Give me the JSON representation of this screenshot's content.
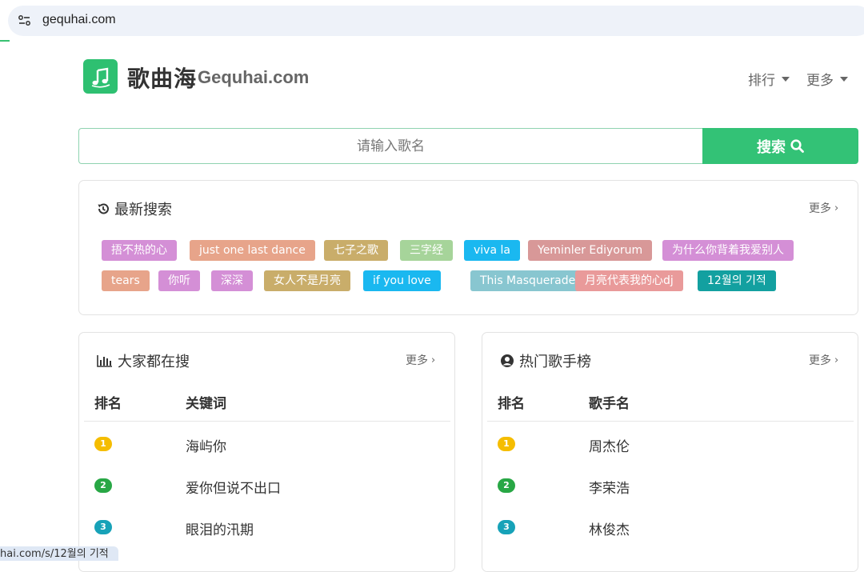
{
  "browser": {
    "url": "gequhai.com"
  },
  "header": {
    "logo_cn": "歌曲海",
    "logo_en": "Gequhai.com",
    "nav": [
      {
        "label": "排行"
      },
      {
        "label": "更多"
      }
    ]
  },
  "search": {
    "placeholder": "请输入歌名",
    "button_label": "搜索"
  },
  "recent": {
    "title": "最新搜索",
    "more": "更多",
    "tags": [
      {
        "text": "捂不热的心",
        "color": "#d48fd6"
      },
      {
        "text": "just one last dance",
        "color": "#e7a48a"
      },
      {
        "text": "七子之歌",
        "color": "#c9ad6a"
      },
      {
        "text": "三字经",
        "color": "#a6d49a"
      },
      {
        "text": "viva la",
        "color": "#1ab8f0"
      },
      {
        "text": "Yeminler Ediyorum",
        "color": "#d89898"
      },
      {
        "text": "为什么你背着我爱别人",
        "color": "#d48fd6"
      },
      {
        "text": "tears",
        "color": "#e7a48a"
      },
      {
        "text": "你听",
        "color": "#d48fd6"
      },
      {
        "text": "深深",
        "color": "#d48fd6"
      },
      {
        "text": "女人不是月亮",
        "color": "#c9ad6a"
      },
      {
        "text": "if you love",
        "color": "#1ab8f0"
      },
      {
        "text": "This Masquerade",
        "color": "#88c6d0"
      },
      {
        "text": "月亮代表我的心dj",
        "color": "#e99a9a"
      },
      {
        "text": "12월의 기적",
        "color": "#13a0a0"
      }
    ]
  },
  "popular": {
    "title": "大家都在搜",
    "more": "更多",
    "col_rank": "排名",
    "col_name": "关键词",
    "rows": [
      {
        "rank": "1",
        "name": "海屿你",
        "color": "#f5bd00"
      },
      {
        "rank": "2",
        "name": "爱你但说不出口",
        "color": "#28a745"
      },
      {
        "rank": "3",
        "name": "眼泪的汛期",
        "color": "#17a2b8"
      }
    ]
  },
  "singers": {
    "title": "热门歌手榜",
    "more": "更多",
    "col_rank": "排名",
    "col_name": "歌手名",
    "rows": [
      {
        "rank": "1",
        "name": "周杰伦",
        "color": "#f5bd00"
      },
      {
        "rank": "2",
        "name": "李荣浩",
        "color": "#28a745"
      },
      {
        "rank": "3",
        "name": "林俊杰",
        "color": "#17a2b8"
      }
    ]
  },
  "status_bar": {
    "text": "hai.com/s/12월의 기적"
  },
  "colors": {
    "accent": "#33c276",
    "logo": "#2ec071"
  }
}
